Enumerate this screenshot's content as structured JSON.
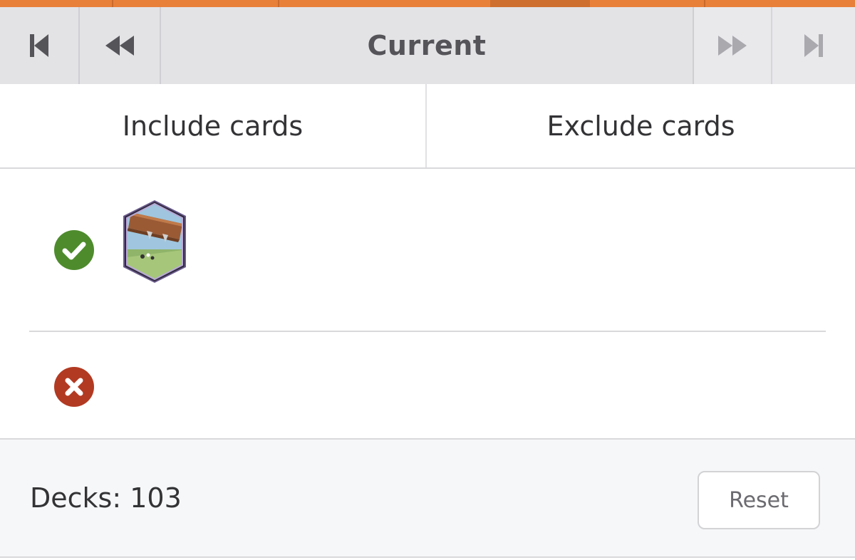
{
  "nav": {
    "first_icon": "skip-to-first-icon",
    "prev_icon": "rewind-icon",
    "current_label": "Current",
    "next_icon": "fast-forward-icon",
    "last_icon": "skip-to-last-icon"
  },
  "tabs": [
    {
      "label": "Include cards"
    },
    {
      "label": "Exclude cards"
    }
  ],
  "include_row": {
    "status_icon": "check-circle-icon",
    "status_color": "#4e8b2d",
    "cards": [
      {
        "icon": "log-card-icon"
      }
    ]
  },
  "exclude_row": {
    "status_icon": "x-circle-icon",
    "status_color": "#b23a22",
    "cards": []
  },
  "footer": {
    "decks_label": "Decks: 103",
    "reset_label": "Reset"
  },
  "colors": {
    "accent_orange": "#e8803a",
    "nav_bg": "#e3e3e6"
  }
}
